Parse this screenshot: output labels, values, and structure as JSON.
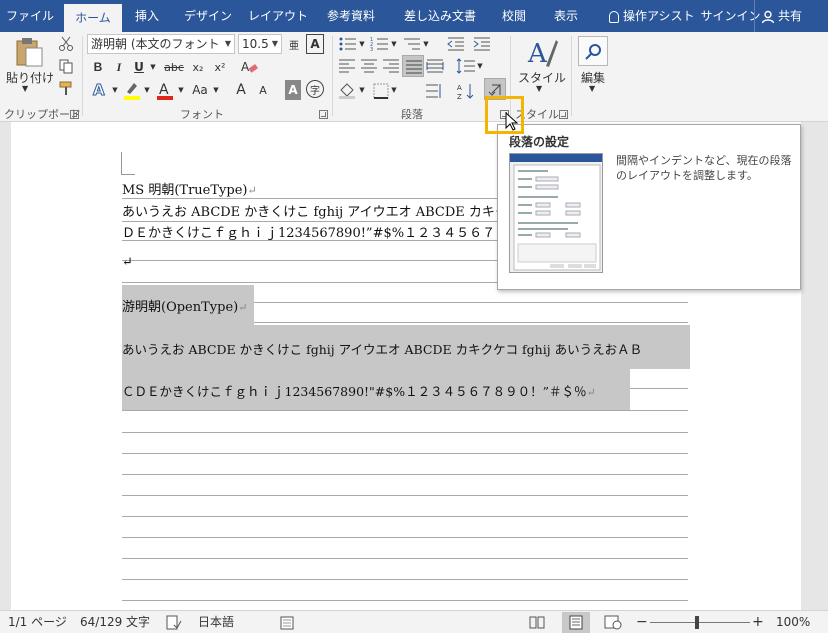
{
  "tabs": [
    {
      "label": "ファイル",
      "active": false
    },
    {
      "label": "ホーム",
      "active": true
    },
    {
      "label": "挿入",
      "active": false
    },
    {
      "label": "デザイン",
      "active": false
    },
    {
      "label": "レイアウト",
      "active": false
    },
    {
      "label": "参考資料",
      "active": false
    },
    {
      "label": "差し込み文書",
      "active": false
    },
    {
      "label": "校閲",
      "active": false
    },
    {
      "label": "表示",
      "active": false
    }
  ],
  "tell_me": "操作アシスト",
  "sign_in": "サインイン",
  "share": "共有",
  "clipboard": {
    "paste_label": "貼り付け",
    "group_label": "クリップボード"
  },
  "font": {
    "name": "游明朝 (本文のフォント - E",
    "size": "10.5",
    "group_label": "フォント",
    "bold": "B",
    "italic": "I",
    "underline": "U",
    "strike": "abc",
    "subscript": "x₂",
    "superscript": "x²",
    "grow": "A",
    "shrink": "A",
    "color_a": "A",
    "char_shade": "A",
    "enclose": "字",
    "aa": "Aa",
    "ruby": "亜"
  },
  "paragraph": {
    "group_label": "段落"
  },
  "styles": {
    "label": "スタイル",
    "group_label": "スタイル"
  },
  "editing": {
    "label": "編集"
  },
  "colors": {
    "accent": "#2b579a",
    "highlight_box": "#f5b400",
    "shade": "#c7c7c7",
    "red": "#e0261b",
    "yellow": "#ffff00"
  },
  "tooltip": {
    "title": "段落の設定",
    "description": "間隔やインデントなど、現在の段落のレイアウトを調整します。"
  },
  "document": {
    "lines": [
      "MS 明朝(TrueType)",
      "あいうえお ABCDE かきくけこ fghij アイウエオ ABCDE カキク",
      "ＤＥかきくけこｆｇｈｉｊ1234567890!”#$%１２３４５６７"
    ],
    "shaded_lines": [
      "游明朝(OpenType)",
      "あいうえお ABCDE かきくけこ fghij アイウエオ ABCDE カキクケコ fghij あいうえおＡＢ",
      "ＣＤＥかきくけこｆｇｈｉｊ1234567890!\"#$%１２３４５６７８９０！”＃＄％"
    ],
    "para_mark": "↵"
  },
  "status": {
    "page": "1/1 ページ",
    "words": "64/129 文字",
    "language": "日本語",
    "zoom": "100%",
    "zoom_minus": "−",
    "zoom_plus": "+"
  }
}
